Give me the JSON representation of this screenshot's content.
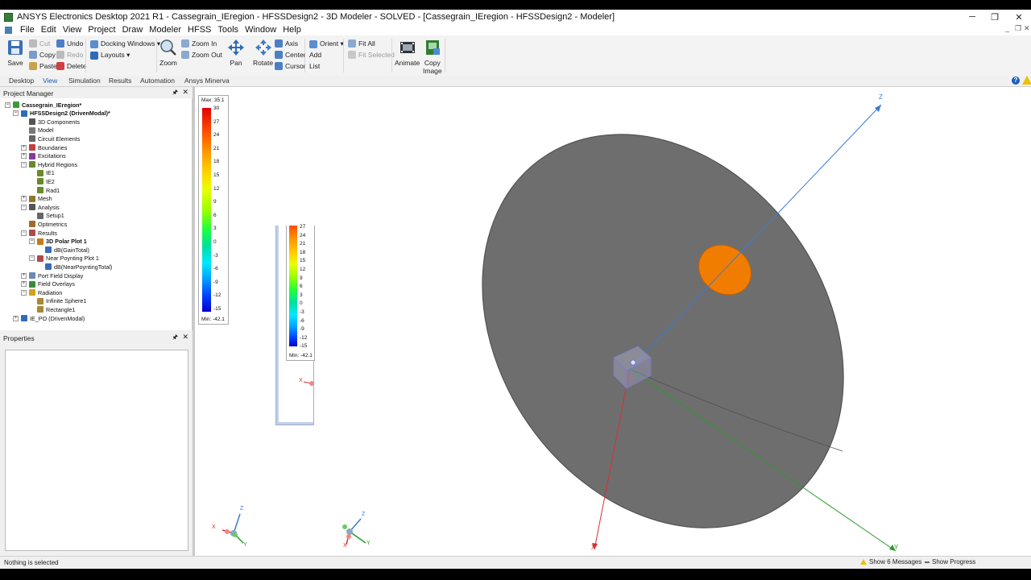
{
  "window": {
    "title": "ANSYS Electronics Desktop 2021 R1 - Cassegrain_IEregion - HFSSDesign2 - 3D Modeler - SOLVED - [Cassegrain_IEregion - HFSSDesign2 - Modeler]",
    "minimize": "─",
    "restore": "❐",
    "close": "✕"
  },
  "menu": [
    "File",
    "Edit",
    "View",
    "Project",
    "Draw",
    "Modeler",
    "HFSS",
    "Tools",
    "Window",
    "Help"
  ],
  "mdi_controls": [
    "_",
    "❐",
    "✕"
  ],
  "ribbon": {
    "save": "Save",
    "cut": "Cut",
    "undo": "Undo",
    "copy": "Copy",
    "redo": "Redo",
    "paste": "Paste",
    "delete": "Delete",
    "docking_windows": "Docking Windows ▾",
    "layouts": "Layouts ▾",
    "zoom": "Zoom",
    "zoom_in": "Zoom In",
    "zoom_out": "Zoom Out",
    "pan": "Pan",
    "rotate": "Rotate",
    "axis": "Axis",
    "center": "Center",
    "cursor": "Cursor",
    "orient": "Orient ▾",
    "add": "Add",
    "list": "List",
    "fit_all": "Fit All",
    "fit_selected": "Fit Selected",
    "animate": "Animate",
    "copy_image_1": "Copy",
    "copy_image_2": "Image"
  },
  "tabs": [
    "Desktop",
    "View",
    "Simulation",
    "Results",
    "Automation",
    "Ansys Minerva"
  ],
  "active_tab": "View",
  "project_manager": {
    "title": "Project Manager",
    "pin": "🖈",
    "close": "✕",
    "nodes": [
      {
        "label": "Cassegrain_IEregion*",
        "exp": "−",
        "bold": true
      },
      {
        "label": "HFSSDesign2 (DrivenModal)*",
        "exp": "−",
        "bold": true
      },
      {
        "label": "3D Components",
        "exp": ""
      },
      {
        "label": "Model",
        "exp": ""
      },
      {
        "label": "Circuit Elements",
        "exp": ""
      },
      {
        "label": "Boundaries",
        "exp": "+"
      },
      {
        "label": "Excitations",
        "exp": "+"
      },
      {
        "label": "Hybrid Regions",
        "exp": "−"
      },
      {
        "label": "IE1",
        "exp": ""
      },
      {
        "label": "IE2",
        "exp": ""
      },
      {
        "label": "Rad1",
        "exp": ""
      },
      {
        "label": "Mesh",
        "exp": "+"
      },
      {
        "label": "Analysis",
        "exp": "−"
      },
      {
        "label": "Setup1",
        "exp": ""
      },
      {
        "label": "Optimetrics",
        "exp": ""
      },
      {
        "label": "Results",
        "exp": "−"
      },
      {
        "label": "3D Polar Plot 1",
        "exp": "−",
        "bold": true
      },
      {
        "label": "dB(GainTotal)",
        "exp": ""
      },
      {
        "label": "Near Poynting Plot 1",
        "exp": "−"
      },
      {
        "label": "dB(NearPoyntingTotal)",
        "exp": ""
      },
      {
        "label": "Port Field Display",
        "exp": "+"
      },
      {
        "label": "Field Overlays",
        "exp": "+"
      },
      {
        "label": "Radiation",
        "exp": "−"
      },
      {
        "label": "Infinite Sphere1",
        "exp": ""
      },
      {
        "label": "Rectangle1",
        "exp": ""
      },
      {
        "label": "IE_PO (DrivenModal)",
        "exp": "+"
      }
    ]
  },
  "properties": {
    "title": "Properties",
    "pin": "🖈",
    "close": "✕"
  },
  "legend_main": {
    "max": "Max: 35.1",
    "min": "Min: -42.1",
    "ticks": [
      "30",
      "27",
      "24",
      "21",
      "18",
      "15",
      "12",
      "9",
      "6",
      "3",
      "0",
      "-3",
      "-6",
      "-9",
      "-12",
      "-15"
    ]
  },
  "legend_small": {
    "min": "Min: -42.1",
    "ticks": [
      "27",
      "24",
      "21",
      "18",
      "15",
      "12",
      "9",
      "6",
      "3",
      "0",
      "-3",
      "-6",
      "-9",
      "-12",
      "-15"
    ]
  },
  "axes": {
    "x": "X",
    "y": "Y",
    "z": "Z"
  },
  "status": {
    "text": "Nothing is selected",
    "messages": "Show 6 Messages",
    "progress": "Show Progress"
  },
  "colors": {
    "accent": "#1a5fb4",
    "dish": "#6b6b6b",
    "subreflector": "#f07d00",
    "z_axis": "#3a7bd5",
    "x_axis": "#d63030",
    "y_axis": "#2a9a2a"
  }
}
